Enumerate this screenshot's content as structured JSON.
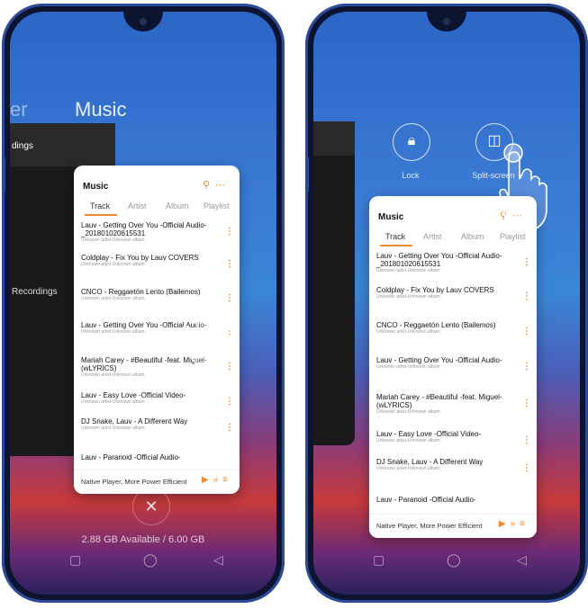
{
  "left": {
    "ghost_letter": "er",
    "app_title": "Music",
    "black_card": {
      "header": "dings",
      "label": "Recordings"
    },
    "music": {
      "title": "Music",
      "tabs": [
        "Track",
        "Artist",
        "Album",
        "Playlist"
      ],
      "tracks": [
        {
          "name": "Lauv - Getting Over You -Official Audio-_201801020615531",
          "sub": "Unknown artist-Unknown album"
        },
        {
          "name": "Coldplay - Fix You by Lauv COVERS",
          "sub": "Unknown artist-Unknown album"
        },
        {
          "name": "CNCO - Reggaetón Lento (Bailemos)",
          "sub": "Unknown artist-Unknown album"
        },
        {
          "name": "Lauv - Getting Over You -Official Audio-",
          "sub": "Unknown artist-Unknown album"
        },
        {
          "name": "Mariah Carey - #Beautiful -feat. Miguel- (wLYRICS)",
          "sub": "Unknown artist-Unknown album"
        },
        {
          "name": "Lauv - Easy Love -Official Video-",
          "sub": "Unknown artist-Unknown album"
        },
        {
          "name": "DJ Snake, Lauv - A Different Way",
          "sub": "Unknown artist-Unknown album"
        },
        {
          "name": "Lauv - Paranoid -Official Audio-",
          "sub": ""
        }
      ],
      "footer": "Native Player, More Power Efficient"
    },
    "memory": "2.88 GB Available / 6.00 GB",
    "close_glyph": "✕"
  },
  "right": {
    "lock_label": "Lock",
    "split_label": "Split-screen",
    "music": {
      "title": "Music",
      "tabs": [
        "Track",
        "Artist",
        "Album",
        "Playlist"
      ],
      "tracks": [
        {
          "name": "Lauv - Getting Over You -Official Audio-_201801020615531",
          "sub": "Unknown artist-Unknown album"
        },
        {
          "name": "Coldplay - Fix You by Lauv COVERS",
          "sub": "Unknown artist-Unknown album"
        },
        {
          "name": "CNCO - Reggaetón Lento (Bailemos)",
          "sub": "Unknown artist-Unknown album"
        },
        {
          "name": "Lauv - Getting Over You -Official Audio-",
          "sub": "Unknown artist-Unknown album"
        },
        {
          "name": "Mariah Carey - #Beautiful -feat. Miguel- (wLYRICS)",
          "sub": "Unknown artist-Unknown album"
        },
        {
          "name": "Lauv - Easy Love -Official Video-",
          "sub": "Unknown artist-Unknown album"
        },
        {
          "name": "DJ Snake, Lauv - A Different Way",
          "sub": "Unknown artist-Unknown album"
        },
        {
          "name": "Lauv - Paranoid -Official Audio-",
          "sub": ""
        }
      ],
      "footer": "Native Player, More Power Efficient"
    }
  },
  "colors": {
    "accent": "#f28a2e"
  }
}
